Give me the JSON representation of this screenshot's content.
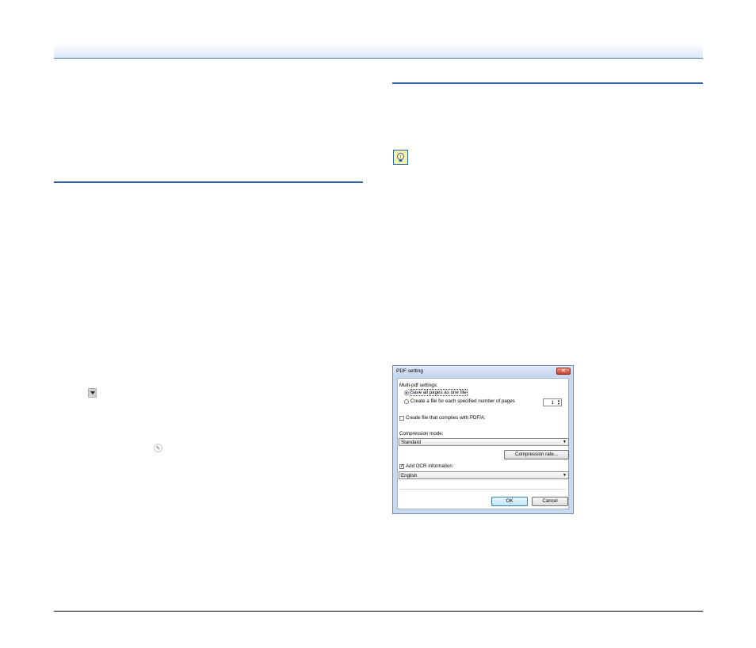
{
  "dialog": {
    "title": "PDF setting",
    "close_glyph": "✕",
    "multi_pdf_label": "Multi-pdf settings:",
    "option_save_all": "Save all pages as one file",
    "option_each_pages": "Create a file for each specified number of pages",
    "pages_value": "1",
    "pdfa_label": "Create file that complies with PDF/A:",
    "compression_mode_label": "Compression mode:",
    "compression_mode_value": "Standard",
    "compression_rate_button": "Compression rate...",
    "add_ocr_label": "Add OCR information",
    "ocr_language_value": "English",
    "ok_button": "OK",
    "cancel_button": "Cancel"
  },
  "icons": {
    "hint": "lightbulb-hint-icon",
    "dropdown": "dropdown-arrow-icon",
    "edit": "pencil-icon"
  },
  "colors": {
    "rule_blue": "#2f63a8",
    "header_gradient_end": "#dde8f6"
  }
}
